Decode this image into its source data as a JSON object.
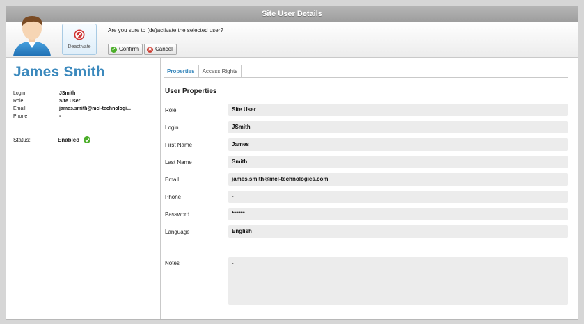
{
  "window": {
    "title": "Site User Details"
  },
  "toolbar": {
    "deactivate_label": "Deactivate",
    "question": "Are you sure to (de)activate the selected user?",
    "confirm_label": "Confirm",
    "cancel_label": "Cancel",
    "icons": {
      "deactivate": "no-entry-icon",
      "confirm": "check-icon",
      "cancel": "x-icon"
    },
    "colors": {
      "deactivate": "#d03535",
      "confirm": "#4cae2a",
      "cancel": "#cc3a2f"
    }
  },
  "profile": {
    "name": "James Smith",
    "fields": [
      {
        "label": "Login",
        "value": "JSmith"
      },
      {
        "label": "Role",
        "value": "Site User"
      },
      {
        "label": "Email",
        "value": "james.smith@mcl-technologi..."
      },
      {
        "label": "Phone",
        "value": "-"
      }
    ],
    "status_label": "Status:",
    "status_value": "Enabled",
    "status_icon": "check-circle-icon",
    "accent_color": "#3b89bd"
  },
  "tabs": [
    {
      "label": "Properties",
      "active": true
    },
    {
      "label": "Access Rights",
      "active": false
    }
  ],
  "properties": {
    "title": "User Properties",
    "rows": [
      {
        "label": "Role",
        "value": "Site User"
      },
      {
        "label": "Login",
        "value": "JSmith"
      },
      {
        "label": "First Name",
        "value": "James"
      },
      {
        "label": "Last Name",
        "value": "Smith"
      },
      {
        "label": "Email",
        "value": "james.smith@mcl-technologies.com"
      },
      {
        "label": "Phone",
        "value": "-"
      },
      {
        "label": "Password",
        "value": "******"
      },
      {
        "label": "Language",
        "value": "English"
      }
    ],
    "notes_label": "Notes",
    "notes_value": "-"
  }
}
